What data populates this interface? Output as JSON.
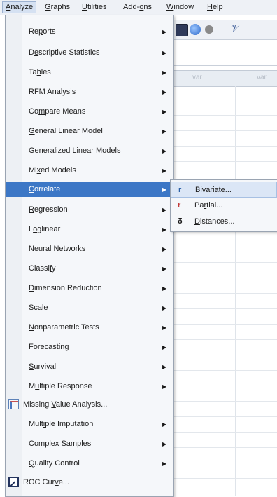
{
  "menubar": {
    "items": [
      {
        "label": "Analyze",
        "mn": "A",
        "rest": "nalyze"
      },
      {
        "label": "Graphs",
        "mn": "G",
        "rest": "raphs"
      },
      {
        "label": "Utilities",
        "mn": "U",
        "rest": "tilities"
      },
      {
        "label": "Add-ons",
        "pre": "Add-",
        "mn": "o",
        "rest": "ns"
      },
      {
        "label": "Window",
        "mn": "W",
        "rest": "indow"
      },
      {
        "label": "Help",
        "mn": "H",
        "rest": "elp"
      }
    ]
  },
  "toolbar": {
    "icon_4": "𝒱"
  },
  "grid": {
    "col_1": "var",
    "col_2": "var"
  },
  "analyze_menu": {
    "items": [
      {
        "pre": "Re",
        "mn": "p",
        "rest": "orts"
      },
      {
        "pre": "D",
        "mn": "e",
        "rest": "scriptive Statistics"
      },
      {
        "pre": "Ta",
        "mn": "b",
        "rest": "les"
      },
      {
        "pre": "RFM Analys",
        "mn": "i",
        "rest": "s"
      },
      {
        "pre": "Co",
        "mn": "m",
        "rest": "pare Means"
      },
      {
        "pre": "",
        "mn": "G",
        "rest": "eneral Linear Model"
      },
      {
        "pre": "Generali",
        "mn": "z",
        "rest": "ed Linear Models"
      },
      {
        "pre": "Mi",
        "mn": "x",
        "rest": "ed Models"
      },
      {
        "pre": "",
        "mn": "C",
        "rest": "orrelate"
      },
      {
        "pre": "",
        "mn": "R",
        "rest": "egression"
      },
      {
        "pre": "L",
        "mn": "o",
        "rest": "glinear"
      },
      {
        "pre": "Neural Net",
        "mn": "w",
        "rest": "orks"
      },
      {
        "pre": "Classi",
        "mn": "f",
        "rest": "y"
      },
      {
        "pre": "",
        "mn": "D",
        "rest": "imension Reduction"
      },
      {
        "pre": "Sc",
        "mn": "a",
        "rest": "le"
      },
      {
        "pre": "",
        "mn": "N",
        "rest": "onparametric Tests"
      },
      {
        "pre": "Forecas",
        "mn": "t",
        "rest": "ing"
      },
      {
        "pre": "",
        "mn": "S",
        "rest": "urvival"
      },
      {
        "pre": "M",
        "mn": "u",
        "rest": "ltiple Response"
      },
      {
        "pre": "Missing ",
        "mn": "V",
        "rest": "alue Analysis..."
      },
      {
        "pre": "Mult",
        "mn": "i",
        "rest": "ple Imputation"
      },
      {
        "pre": "Comp",
        "mn": "l",
        "rest": "ex Samples"
      },
      {
        "pre": "",
        "mn": "Q",
        "rest": "uality Control"
      },
      {
        "pre": "ROC Cur",
        "mn": "v",
        "rest": "e..."
      }
    ],
    "arrow": "▶"
  },
  "correlate_submenu": {
    "items": [
      {
        "icon": "r",
        "pre": "",
        "mn": "B",
        "rest": "ivariate..."
      },
      {
        "icon": "r",
        "pre": "Pa",
        "mn": "r",
        "rest": "tial..."
      },
      {
        "icon": "δ",
        "pre": "",
        "mn": "D",
        "rest": "istances..."
      }
    ]
  }
}
